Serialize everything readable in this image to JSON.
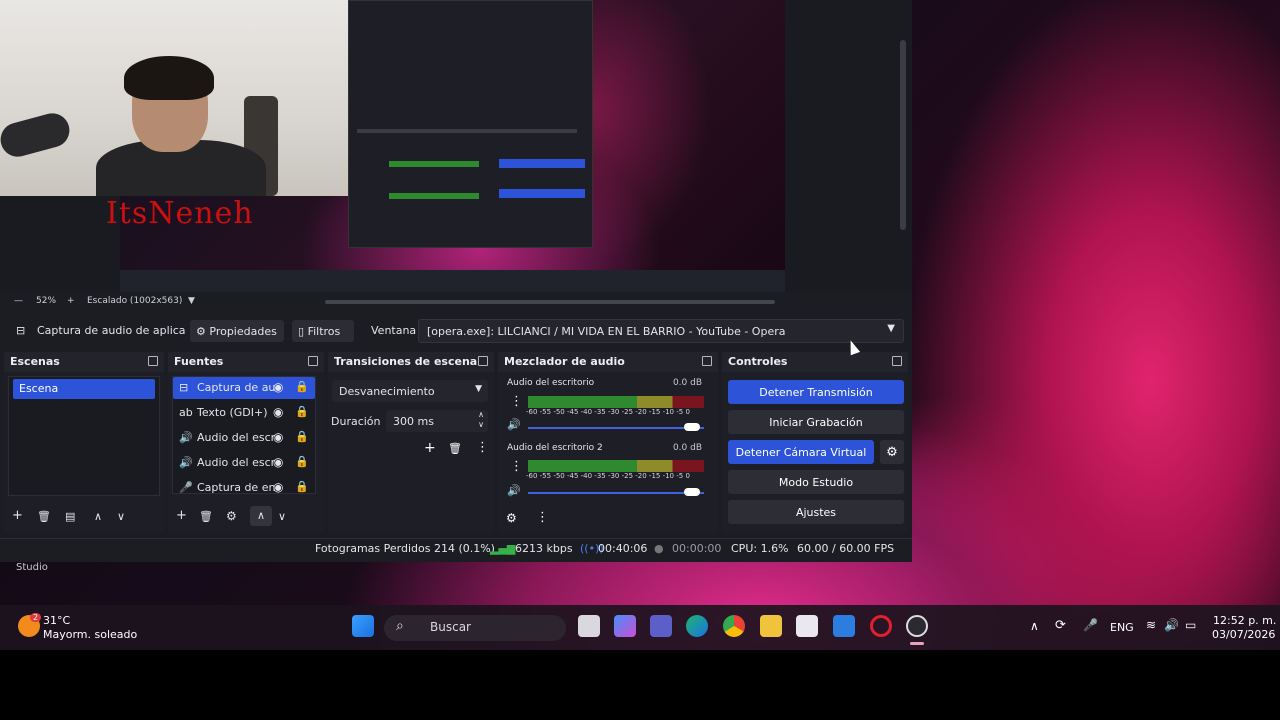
{
  "preview": {
    "zoom": "52%",
    "scale_label": "Escalado (1002x563)",
    "watermark": "ItsNeneh"
  },
  "source_bar": {
    "source_name": "Captura de audio de aplica",
    "properties": "Propiedades",
    "filters": "Filtros",
    "window_label": "Ventana",
    "window_value": "[opera.exe]: LILCIANCI / MI VIDA EN EL BARRIO - YouTube - Opera"
  },
  "scenes": {
    "title": "Escenas",
    "items": [
      "Escena"
    ]
  },
  "sources": {
    "title": "Fuentes",
    "items": [
      {
        "icon": "app-audio-icon",
        "label": "Captura de au"
      },
      {
        "icon": "text-icon",
        "label": "Texto (GDI+)"
      },
      {
        "icon": "speaker-icon",
        "label": "Audio del escr"
      },
      {
        "icon": "speaker-icon",
        "label": "Audio del escr"
      },
      {
        "icon": "microphone-icon",
        "label": "Captura de en"
      }
    ]
  },
  "transitions": {
    "title": "Transiciones de escena",
    "type": "Desvanecimiento",
    "duration_label": "Duración",
    "duration_value": "300 ms"
  },
  "mixer": {
    "title": "Mezclador de audio",
    "scale": "-60 -55 -50 -45 -40 -35 -30 -25 -20 -15 -10 -5 0",
    "channels": [
      {
        "name": "Audio del escritorio",
        "level": "0.0 dB",
        "volume": 1.0
      },
      {
        "name": "Audio del escritorio 2",
        "level": "0.0 dB",
        "volume": 1.0
      }
    ]
  },
  "controls": {
    "title": "Controles",
    "stop_stream": "Detener Transmisión",
    "start_record": "Iniciar Grabación",
    "stop_virtualcam": "Detener Cámara Virtual",
    "studio_mode": "Modo Estudio",
    "settings": "Ajustes",
    "accent": "#2d54d8"
  },
  "status": {
    "dropped": "Fotogramas Perdidos 214 (0.1%)",
    "bitrate": "6213 kbps",
    "live_time": "00:40:06",
    "rec_time": "00:00:00",
    "cpu": "CPU: 1.6%",
    "fps": "60.00 / 60.00 FPS"
  },
  "studio_label": "Studio",
  "taskbar": {
    "weather_temp": "31°C",
    "weather_desc": "Mayorm. soleado",
    "weather_badge": "2",
    "search": "Buscar",
    "lang": "ENG",
    "time": "12:52 p. m.",
    "date": "03/07/2026"
  }
}
